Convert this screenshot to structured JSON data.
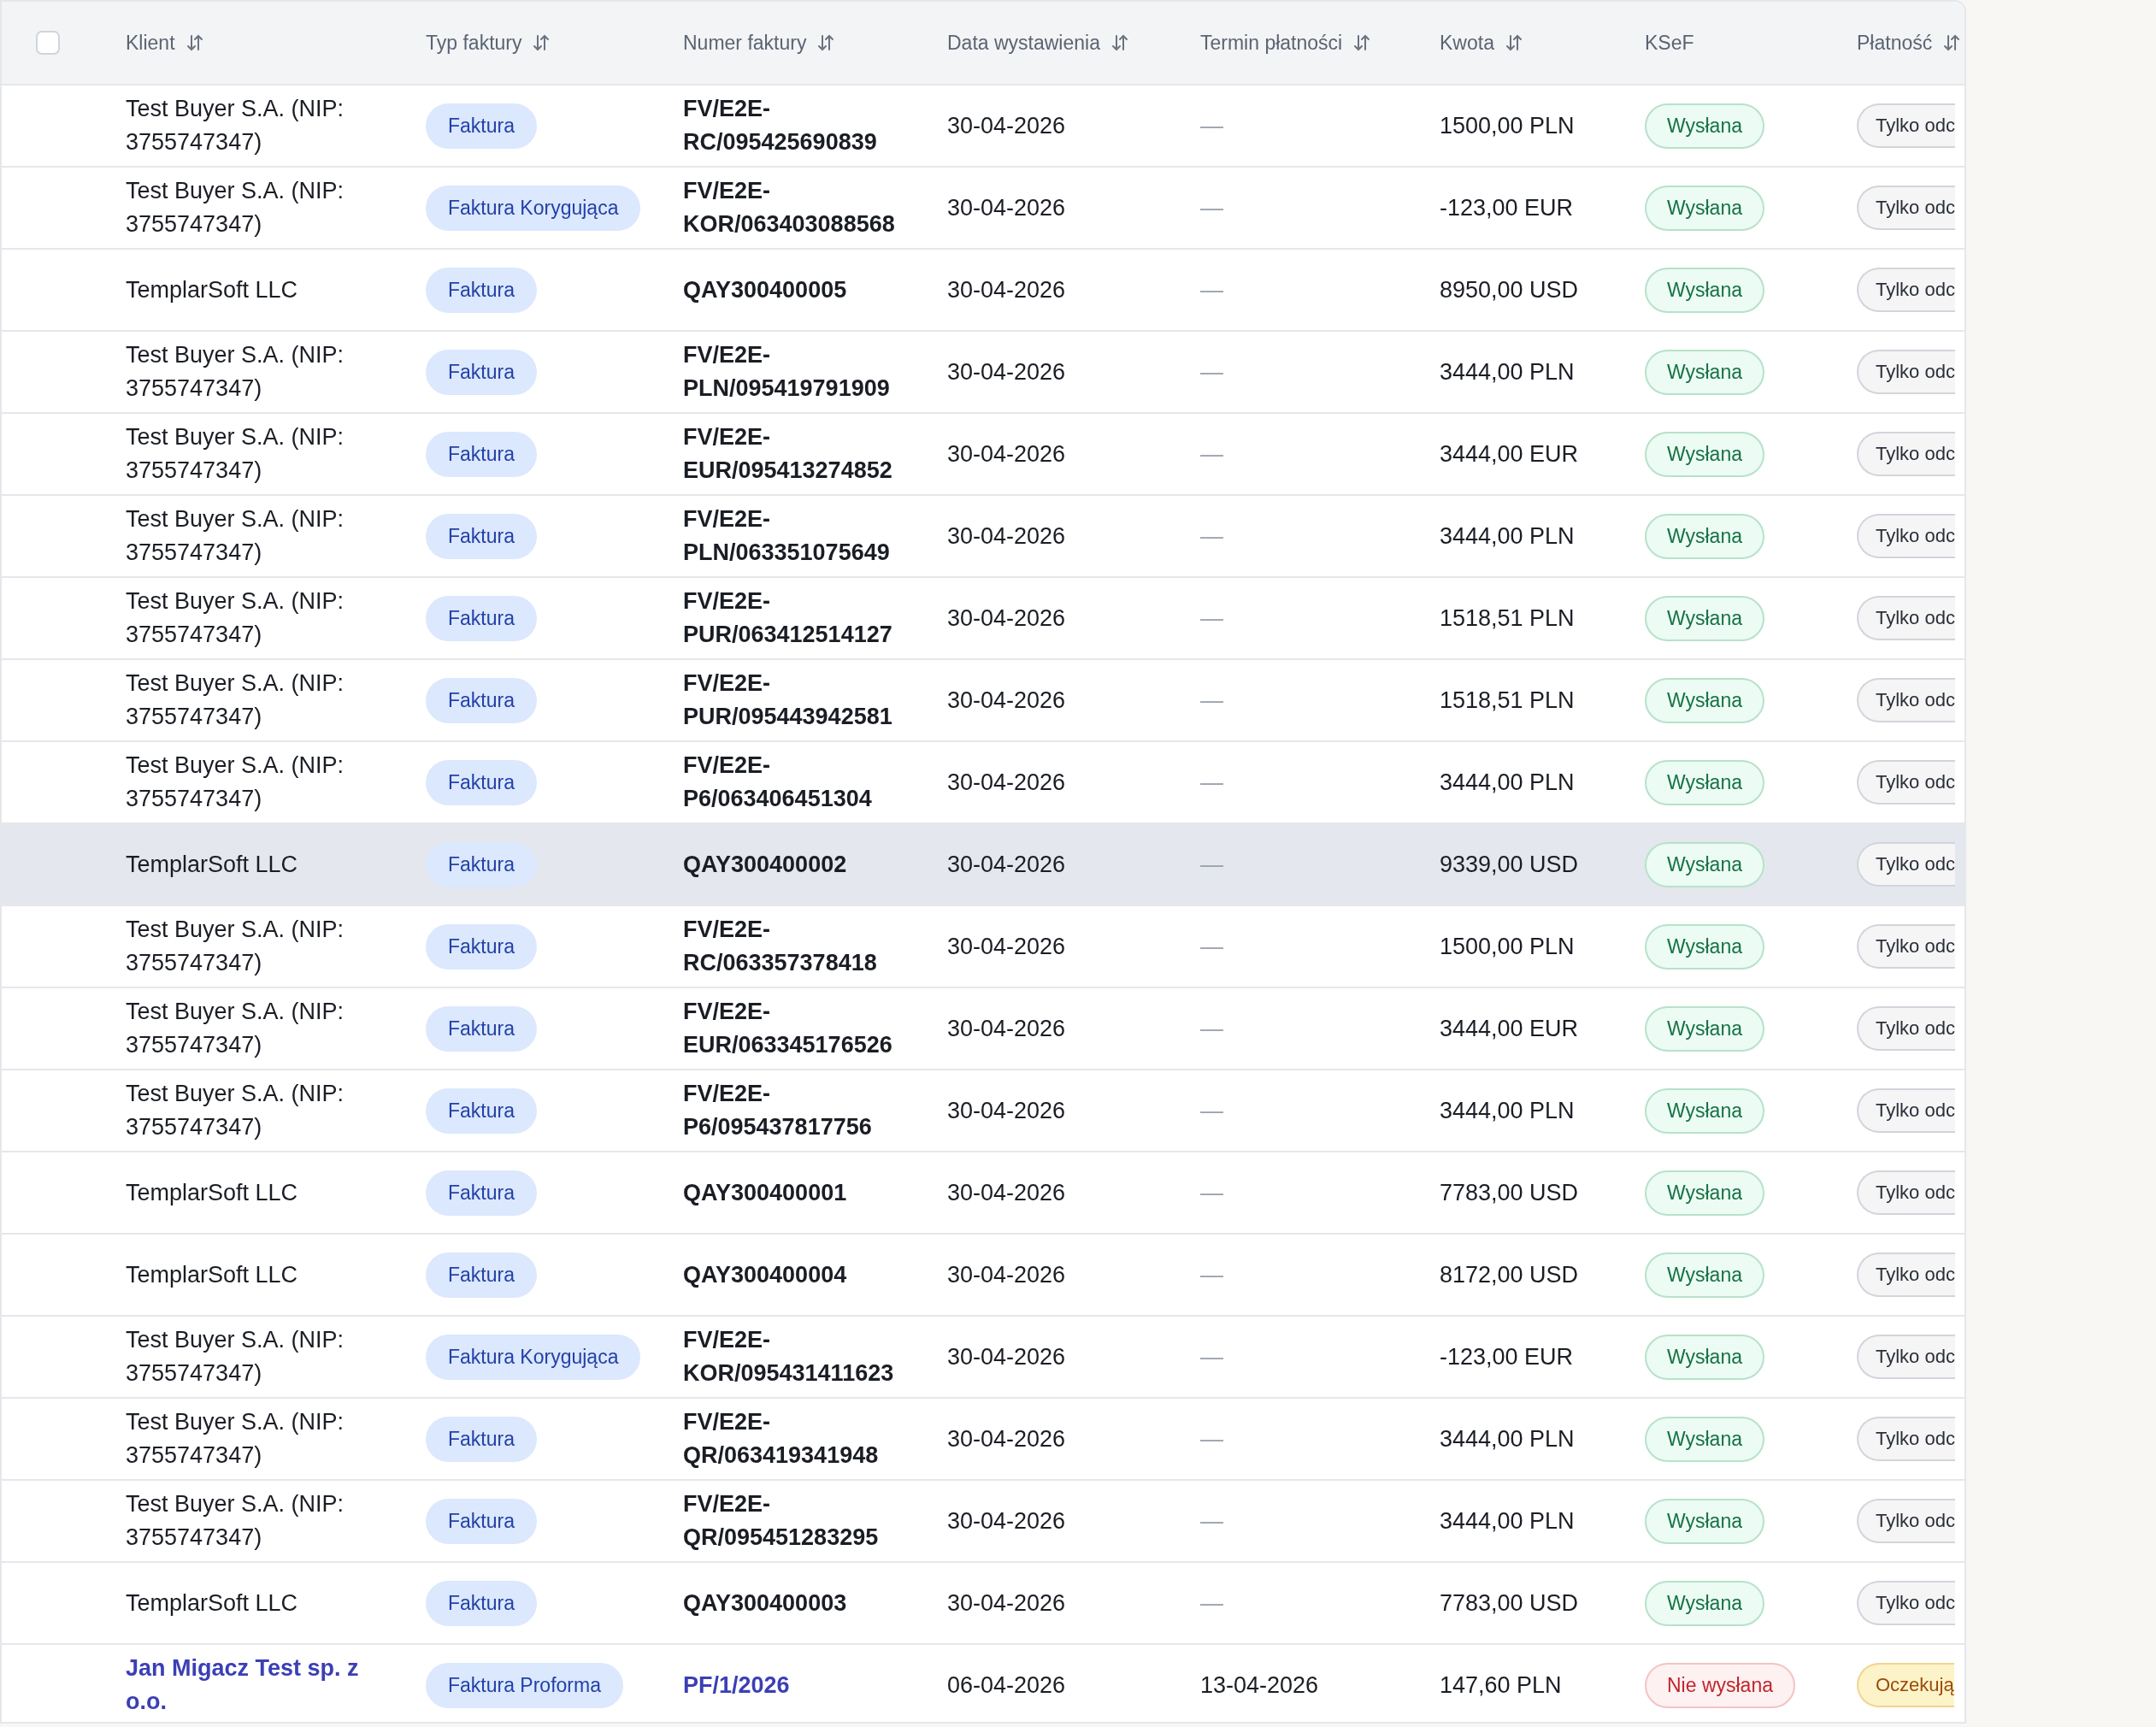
{
  "table": {
    "select_all": {
      "checked": false
    },
    "columns": [
      {
        "label": "Klient",
        "sortable": true
      },
      {
        "label": "Typ faktury",
        "sortable": true
      },
      {
        "label": "Numer faktury",
        "sortable": true
      },
      {
        "label": "Data wystawienia",
        "sortable": true
      },
      {
        "label": "Termin płatności",
        "sortable": true
      },
      {
        "label": "Kwota",
        "sortable": true
      },
      {
        "label": "KSeF",
        "sortable": false
      },
      {
        "label": "Płatność",
        "sortable": true
      }
    ],
    "rows": [
      {
        "client": "Test Buyer S.A. (NIP: 3755747347)",
        "type": "Faktura",
        "number": "FV/E2E-RC/095425690839",
        "issued": "30-04-2026",
        "due": "—",
        "amount": "1500,00 PLN",
        "ksef": {
          "label": "Wysłana",
          "kind": "sent"
        },
        "payment": {
          "label": "Tylko odc",
          "kind": "readonly"
        },
        "highlighted": false,
        "linked": false
      },
      {
        "client": "Test Buyer S.A. (NIP: 3755747347)",
        "type": "Faktura Korygująca",
        "number": "FV/E2E-KOR/063403088568",
        "issued": "30-04-2026",
        "due": "—",
        "amount": "-123,00 EUR",
        "ksef": {
          "label": "Wysłana",
          "kind": "sent"
        },
        "payment": {
          "label": "Tylko odc",
          "kind": "readonly"
        },
        "highlighted": false,
        "linked": false
      },
      {
        "client": "TemplarSoft LLC",
        "type": "Faktura",
        "number": "QAY300400005",
        "issued": "30-04-2026",
        "due": "—",
        "amount": "8950,00 USD",
        "ksef": {
          "label": "Wysłana",
          "kind": "sent"
        },
        "payment": {
          "label": "Tylko odc",
          "kind": "readonly"
        },
        "highlighted": false,
        "linked": false
      },
      {
        "client": "Test Buyer S.A. (NIP: 3755747347)",
        "type": "Faktura",
        "number": "FV/E2E-PLN/095419791909",
        "issued": "30-04-2026",
        "due": "—",
        "amount": "3444,00 PLN",
        "ksef": {
          "label": "Wysłana",
          "kind": "sent"
        },
        "payment": {
          "label": "Tylko odc",
          "kind": "readonly"
        },
        "highlighted": false,
        "linked": false
      },
      {
        "client": "Test Buyer S.A. (NIP: 3755747347)",
        "type": "Faktura",
        "number": "FV/E2E-EUR/095413274852",
        "issued": "30-04-2026",
        "due": "—",
        "amount": "3444,00 EUR",
        "ksef": {
          "label": "Wysłana",
          "kind": "sent"
        },
        "payment": {
          "label": "Tylko odc",
          "kind": "readonly"
        },
        "highlighted": false,
        "linked": false
      },
      {
        "client": "Test Buyer S.A. (NIP: 3755747347)",
        "type": "Faktura",
        "number": "FV/E2E-PLN/063351075649",
        "issued": "30-04-2026",
        "due": "—",
        "amount": "3444,00 PLN",
        "ksef": {
          "label": "Wysłana",
          "kind": "sent"
        },
        "payment": {
          "label": "Tylko odc",
          "kind": "readonly"
        },
        "highlighted": false,
        "linked": false
      },
      {
        "client": "Test Buyer S.A. (NIP: 3755747347)",
        "type": "Faktura",
        "number": "FV/E2E-PUR/063412514127",
        "issued": "30-04-2026",
        "due": "—",
        "amount": "1518,51 PLN",
        "ksef": {
          "label": "Wysłana",
          "kind": "sent"
        },
        "payment": {
          "label": "Tylko odc",
          "kind": "readonly"
        },
        "highlighted": false,
        "linked": false
      },
      {
        "client": "Test Buyer S.A. (NIP: 3755747347)",
        "type": "Faktura",
        "number": "FV/E2E-PUR/095443942581",
        "issued": "30-04-2026",
        "due": "—",
        "amount": "1518,51 PLN",
        "ksef": {
          "label": "Wysłana",
          "kind": "sent"
        },
        "payment": {
          "label": "Tylko odc",
          "kind": "readonly"
        },
        "highlighted": false,
        "linked": false
      },
      {
        "client": "Test Buyer S.A. (NIP: 3755747347)",
        "type": "Faktura",
        "number": "FV/E2E-P6/063406451304",
        "issued": "30-04-2026",
        "due": "—",
        "amount": "3444,00 PLN",
        "ksef": {
          "label": "Wysłana",
          "kind": "sent"
        },
        "payment": {
          "label": "Tylko odc",
          "kind": "readonly"
        },
        "highlighted": false,
        "linked": false
      },
      {
        "client": "TemplarSoft LLC",
        "type": "Faktura",
        "number": "QAY300400002",
        "issued": "30-04-2026",
        "due": "—",
        "amount": "9339,00 USD",
        "ksef": {
          "label": "Wysłana",
          "kind": "sent"
        },
        "payment": {
          "label": "Tylko odc",
          "kind": "readonly"
        },
        "highlighted": true,
        "linked": false
      },
      {
        "client": "Test Buyer S.A. (NIP: 3755747347)",
        "type": "Faktura",
        "number": "FV/E2E-RC/063357378418",
        "issued": "30-04-2026",
        "due": "—",
        "amount": "1500,00 PLN",
        "ksef": {
          "label": "Wysłana",
          "kind": "sent"
        },
        "payment": {
          "label": "Tylko odc",
          "kind": "readonly"
        },
        "highlighted": false,
        "linked": false
      },
      {
        "client": "Test Buyer S.A. (NIP: 3755747347)",
        "type": "Faktura",
        "number": "FV/E2E-EUR/063345176526",
        "issued": "30-04-2026",
        "due": "—",
        "amount": "3444,00 EUR",
        "ksef": {
          "label": "Wysłana",
          "kind": "sent"
        },
        "payment": {
          "label": "Tylko odc",
          "kind": "readonly"
        },
        "highlighted": false,
        "linked": false
      },
      {
        "client": "Test Buyer S.A. (NIP: 3755747347)",
        "type": "Faktura",
        "number": "FV/E2E-P6/095437817756",
        "issued": "30-04-2026",
        "due": "—",
        "amount": "3444,00 PLN",
        "ksef": {
          "label": "Wysłana",
          "kind": "sent"
        },
        "payment": {
          "label": "Tylko odc",
          "kind": "readonly"
        },
        "highlighted": false,
        "linked": false
      },
      {
        "client": "TemplarSoft LLC",
        "type": "Faktura",
        "number": "QAY300400001",
        "issued": "30-04-2026",
        "due": "—",
        "amount": "7783,00 USD",
        "ksef": {
          "label": "Wysłana",
          "kind": "sent"
        },
        "payment": {
          "label": "Tylko odc",
          "kind": "readonly"
        },
        "highlighted": false,
        "linked": false
      },
      {
        "client": "TemplarSoft LLC",
        "type": "Faktura",
        "number": "QAY300400004",
        "issued": "30-04-2026",
        "due": "—",
        "amount": "8172,00 USD",
        "ksef": {
          "label": "Wysłana",
          "kind": "sent"
        },
        "payment": {
          "label": "Tylko odc",
          "kind": "readonly"
        },
        "highlighted": false,
        "linked": false
      },
      {
        "client": "Test Buyer S.A. (NIP: 3755747347)",
        "type": "Faktura Korygująca",
        "number": "FV/E2E-KOR/095431411623",
        "issued": "30-04-2026",
        "due": "—",
        "amount": "-123,00 EUR",
        "ksef": {
          "label": "Wysłana",
          "kind": "sent"
        },
        "payment": {
          "label": "Tylko odc",
          "kind": "readonly"
        },
        "highlighted": false,
        "linked": false
      },
      {
        "client": "Test Buyer S.A. (NIP: 3755747347)",
        "type": "Faktura",
        "number": "FV/E2E-QR/063419341948",
        "issued": "30-04-2026",
        "due": "—",
        "amount": "3444,00 PLN",
        "ksef": {
          "label": "Wysłana",
          "kind": "sent"
        },
        "payment": {
          "label": "Tylko odc",
          "kind": "readonly"
        },
        "highlighted": false,
        "linked": false
      },
      {
        "client": "Test Buyer S.A. (NIP: 3755747347)",
        "type": "Faktura",
        "number": "FV/E2E-QR/095451283295",
        "issued": "30-04-2026",
        "due": "—",
        "amount": "3444,00 PLN",
        "ksef": {
          "label": "Wysłana",
          "kind": "sent"
        },
        "payment": {
          "label": "Tylko odc",
          "kind": "readonly"
        },
        "highlighted": false,
        "linked": false
      },
      {
        "client": "TemplarSoft LLC",
        "type": "Faktura",
        "number": "QAY300400003",
        "issued": "30-04-2026",
        "due": "—",
        "amount": "7783,00 USD",
        "ksef": {
          "label": "Wysłana",
          "kind": "sent"
        },
        "payment": {
          "label": "Tylko odc",
          "kind": "readonly"
        },
        "highlighted": false,
        "linked": false
      },
      {
        "client": "Jan Migacz Test sp. z o.o.",
        "type": "Faktura Proforma",
        "number": "PF/1/2026",
        "issued": "06-04-2026",
        "due": "13-04-2026",
        "amount": "147,60 PLN",
        "ksef": {
          "label": "Nie wysłana",
          "kind": "not_sent"
        },
        "payment": {
          "label": "Oczekują",
          "kind": "pending"
        },
        "highlighted": false,
        "linked": true
      }
    ]
  }
}
